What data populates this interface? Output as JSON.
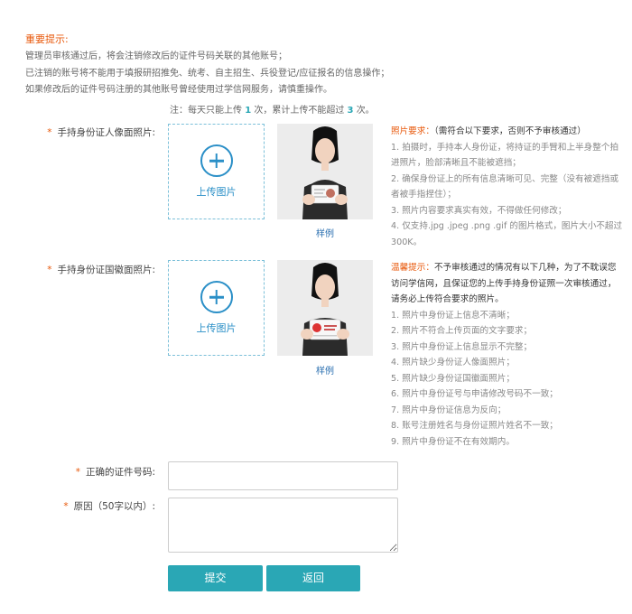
{
  "notice": {
    "title": "重要提示:",
    "lines": [
      "管理员审核通过后，将会注销修改后的证件号码关联的其他账号；",
      "已注销的账号将不能用于填报研招推免、统考、自主招生、兵役登记/应征报名的信息操作；",
      "如果修改后的证件号码注册的其他账号曾经使用过学信网服务，请慎重操作。"
    ]
  },
  "limit": {
    "prefix": "注：每天只能上传",
    "per_day": "1",
    "mid": "次，累计上传不能超过",
    "total": "3",
    "suffix": "次。"
  },
  "front_photo": {
    "required_mark": "*",
    "label": "手持身份证人像面照片:",
    "upload_text": "上传图片",
    "sample_link": "样例",
    "requirements_head": "照片要求：",
    "requirements_note": "（需符合以下要求，否则不予审核通过）",
    "requirements": [
      "1. 拍摄时，手持本人身份证，将持证的手臂和上半身整个拍进照片，脸部清晰且不能被遮挡；",
      "2. 确保身份证上的所有信息清晰可见、完整（没有被遮挡或者被手指捏住）；",
      "3. 照片内容要求真实有效，不得做任何修改；",
      "4. 仅支持.jpg .jpeg .png .gif 的图片格式，图片大小不超过300K。"
    ]
  },
  "back_photo": {
    "required_mark": "*",
    "label": "手持身份证国徽面照片:",
    "upload_text": "上传图片",
    "sample_link": "样例",
    "tips_head": "温馨提示：",
    "tips_intro": "不予审核通过的情况有以下几种，为了不耽误您访问学信网，且保证您的上传手持身份证照一次审核通过，请务必上传符合要求的照片。",
    "tips": [
      "1. 照片中身份证上信息不清晰；",
      "2. 照片不符合上传页面的文字要求；",
      "3. 照片中身份证上信息显示不完整；",
      "4. 照片缺少身份证人像面照片；",
      "5. 照片缺少身份证国徽面照片；",
      "6. 照片中身份证号与申请修改号码不一致；",
      "7. 照片中身份证信息为反向；",
      "8. 账号注册姓名与身份证照片姓名不一致；",
      "9. 照片中身份证不在有效期内。"
    ]
  },
  "form": {
    "id_number_mark": "*",
    "id_number_label": "正确的证件号码:",
    "id_number_value": "",
    "reason_mark": "*",
    "reason_label": "原因（50字以内）:",
    "reason_value": ""
  },
  "buttons": {
    "submit": "提交",
    "back": "返回"
  },
  "colors": {
    "accent": "#2aa7b5",
    "warning": "#e8590c",
    "link": "#2a8fc7"
  },
  "icons": {
    "upload": "plus-circle-icon"
  }
}
